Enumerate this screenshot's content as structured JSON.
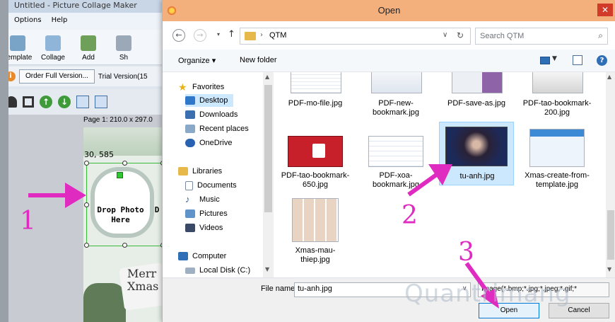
{
  "background_app": {
    "title": "Untitled - Picture Collage Maker",
    "menu": [
      "Options",
      "Help"
    ],
    "ribbon": [
      "Template",
      "Collage",
      "Add",
      "Sh"
    ],
    "order_button": "Order Full Version...",
    "trial_text": "Trial Version(15",
    "page_info": "Page 1: 210.0 x 297.0",
    "coords": "30, 585",
    "drop_text": "Drop Photo Here",
    "drop_text_cut": "D",
    "merry_text": "Merr Xmas"
  },
  "dialog": {
    "title": "Open",
    "close_glyph": "✕",
    "address": {
      "folder": "QTM",
      "separator": "›"
    },
    "search": {
      "placeholder": "Search QTM"
    },
    "command_bar": {
      "organize": "Organize ▾",
      "new_folder": "New folder"
    },
    "nav_pane": {
      "items": [
        {
          "label": "Favorites"
        },
        {
          "label": "Desktop"
        },
        {
          "label": "Downloads"
        },
        {
          "label": "Recent places"
        },
        {
          "label": "OneDrive"
        },
        {
          "label": "Libraries"
        },
        {
          "label": "Documents"
        },
        {
          "label": "Music"
        },
        {
          "label": "Pictures"
        },
        {
          "label": "Videos"
        },
        {
          "label": "Computer"
        },
        {
          "label": "Local Disk (C:)"
        }
      ]
    },
    "files": [
      {
        "name": "PDF-mo-file.jpg"
      },
      {
        "name": "PDF-new-bookmark.jpg"
      },
      {
        "name": "PDF-save-as.jpg"
      },
      {
        "name": "PDF-tao-bookmark-200.jpg"
      },
      {
        "name": "PDF-tao-bookmark-650.jpg"
      },
      {
        "name": "PDF-xoa-bookmark.jpg"
      },
      {
        "name": "tu-anh.jpg"
      },
      {
        "name": "Xmas-create-from-template.jpg"
      },
      {
        "name": "Xmas-mau-thiep.jpg"
      }
    ],
    "bottom": {
      "file_name_label": "File name:",
      "file_name_value": "tu-anh.jpg",
      "filter": "Image(*.bmp;*.jpg;*.jpeg;*.gif;*",
      "open_button": "Open",
      "cancel_button": "Cancel"
    }
  },
  "annotations": {
    "one": "1",
    "two": "2",
    "three": "3",
    "color": "#e02bc0"
  },
  "watermark": "Quantrimang"
}
